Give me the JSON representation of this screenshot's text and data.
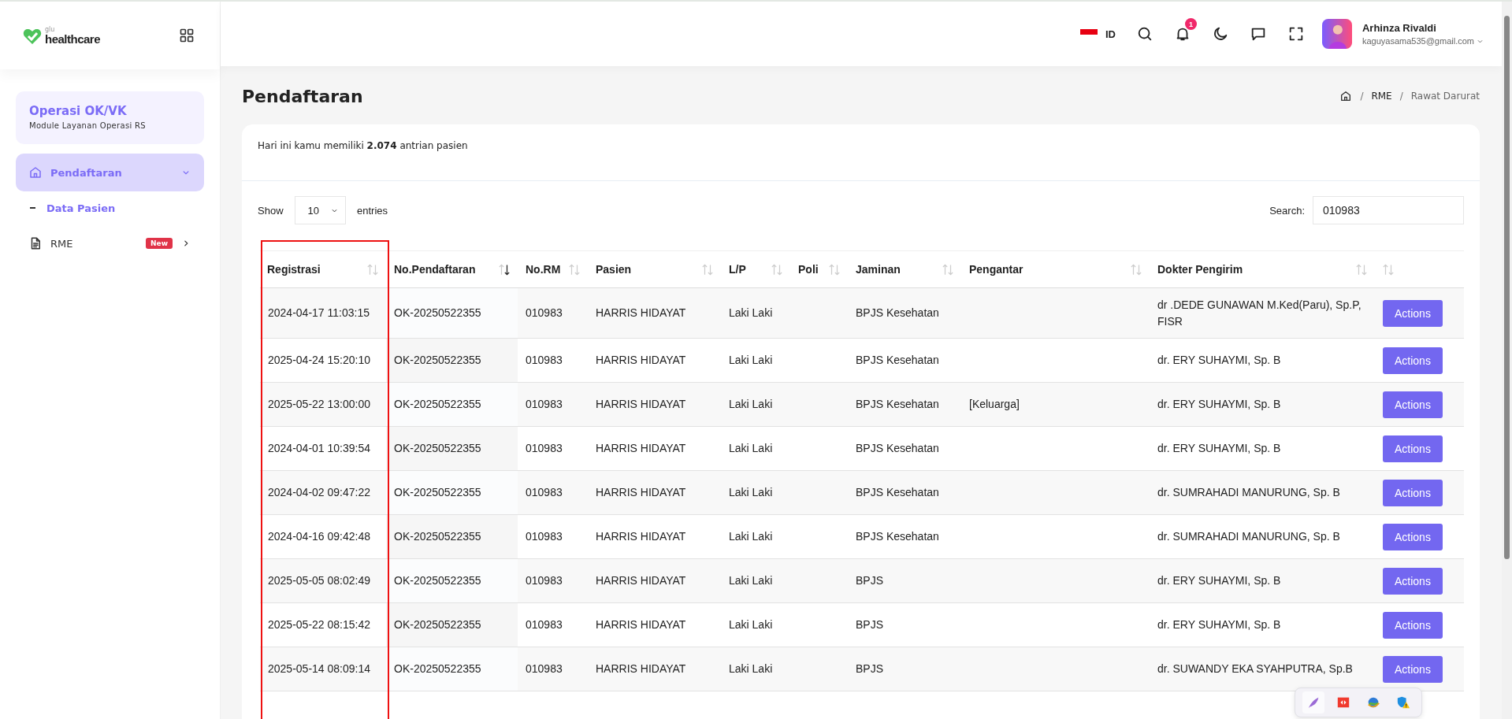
{
  "sidebar": {
    "logo": {
      "small": "glu",
      "name": "healthcare"
    },
    "module": {
      "title": "Operasi OK/VK",
      "subtitle": "Module Layanan Operasi RS"
    },
    "menu": [
      {
        "label": "Pendaftaran",
        "selected": true,
        "expanded": true,
        "children": [
          {
            "label": "Data Pasien",
            "selected": true
          }
        ]
      },
      {
        "label": "RME",
        "badge": "New",
        "selected": false,
        "expanded": false
      }
    ]
  },
  "header": {
    "language": "ID",
    "notifications": "1",
    "user": {
      "name": "Arhinza Rivaldi",
      "email": "kaguyasama535@gmail.com"
    }
  },
  "page": {
    "title": "Pendaftaran",
    "breadcrumb": [
      {
        "separator": "/",
        "label": "RME"
      },
      {
        "separator": "/",
        "label": "Rawat Darurat"
      }
    ]
  },
  "card": {
    "summary": "Hari ini kamu memiliki **2.074** antrian pasien",
    "length": {
      "before": "Show",
      "value": "10",
      "after": "entries"
    },
    "search": {
      "label": "Search:",
      "value": "010983"
    },
    "table": {
      "columns": [
        {
          "label": "Registrasi",
          "sorted": false,
          "highlighted": true
        },
        {
          "label": "No.Pendaftaran",
          "sorted": true,
          "highlighted": false
        },
        {
          "label": "No.RM",
          "sorted": false,
          "highlighted": false
        },
        {
          "label": "Pasien",
          "sorted": false,
          "highlighted": false
        },
        {
          "label": "L/P",
          "sorted": false,
          "highlighted": false
        },
        {
          "label": "Poli",
          "sorted": false,
          "highlighted": false
        },
        {
          "label": "Jaminan",
          "sorted": false,
          "highlighted": false
        },
        {
          "label": "Pengantar",
          "sorted": false,
          "highlighted": false
        },
        {
          "label": "Dokter Pengirim",
          "sorted": false,
          "highlighted": false
        },
        {
          "sorted": false,
          "highlighted": false
        }
      ],
      "rows": [
        [
          "2024-04-17 11:03:15",
          "OK-20250522355",
          "010983",
          "HARRIS HIDAYAT",
          "Laki Laki",
          null,
          "BPJS Kesehatan",
          null,
          "dr .DEDE GUNAWAN M.Ked(Paru), Sp.P, FISR",
          "Actions"
        ],
        [
          "2025-04-24 15:20:10",
          "OK-20250522355",
          "010983",
          "HARRIS HIDAYAT",
          "Laki Laki",
          null,
          "BPJS Kesehatan",
          null,
          "dr. ERY SUHAYMI, Sp. B",
          "Actions"
        ],
        [
          "2025-05-22 13:00:00",
          "OK-20250522355",
          "010983",
          "HARRIS HIDAYAT",
          "Laki Laki",
          null,
          "BPJS Kesehatan",
          "[Keluarga]",
          "dr. ERY SUHAYMI, Sp. B",
          "Actions"
        ],
        [
          "2024-04-01 10:39:54",
          "OK-20250522355",
          "010983",
          "HARRIS HIDAYAT",
          "Laki Laki",
          null,
          "BPJS Kesehatan",
          null,
          "dr. ERY SUHAYMI, Sp. B",
          "Actions"
        ],
        [
          "2024-04-02 09:47:22",
          "OK-20250522355",
          "010983",
          "HARRIS HIDAYAT",
          "Laki Laki",
          null,
          "BPJS Kesehatan",
          null,
          "dr. SUMRAHADI MANURUNG, Sp. B",
          "Actions"
        ],
        [
          "2024-04-16 09:42:48",
          "OK-20250522355",
          "010983",
          "HARRIS HIDAYAT",
          "Laki Laki",
          null,
          "BPJS Kesehatan",
          null,
          "dr. SUMRAHADI MANURUNG, Sp. B",
          "Actions"
        ],
        [
          "2025-05-05 08:02:49",
          "OK-20250522355",
          "010983",
          "HARRIS HIDAYAT",
          "Laki Laki",
          null,
          "BPJS",
          null,
          "dr. ERY SUHAYMI, Sp. B",
          "Actions"
        ],
        [
          "2025-05-22 08:15:42",
          "OK-20250522355",
          "010983",
          "HARRIS HIDAYAT",
          "Laki Laki",
          null,
          "BPJS",
          null,
          "dr. ERY SUHAYMI, Sp. B",
          "Actions"
        ],
        [
          "2025-05-14 08:09:14",
          "OK-20250522355",
          "010983",
          "HARRIS HIDAYAT",
          "Laki Laki",
          null,
          "BPJS",
          null,
          "dr. SUWANDY EKA SYAHPUTRA, Sp.B",
          "Actions"
        ]
      ]
    }
  }
}
